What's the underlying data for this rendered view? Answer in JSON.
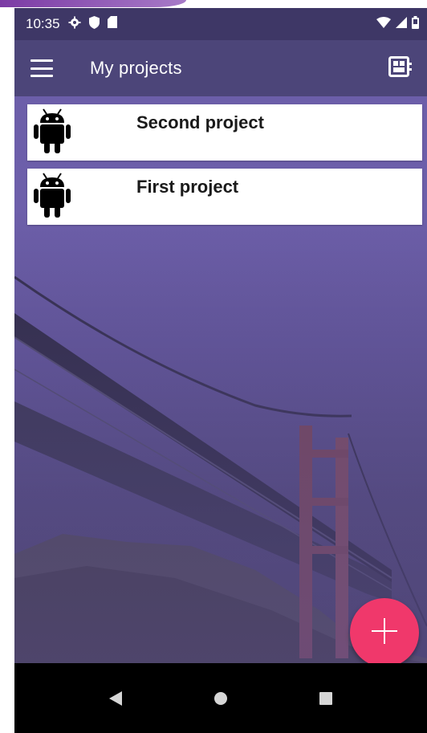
{
  "status_bar": {
    "time": "10:35",
    "left_icons": [
      "settings-icon",
      "shield-icon",
      "sd-card-icon"
    ],
    "right_icons": [
      "wifi-icon",
      "signal-icon",
      "battery-icon"
    ]
  },
  "app_bar": {
    "title": "My projects",
    "menu_icon": "hamburger-menu-icon",
    "action_icon": "dashboard-view-icon"
  },
  "projects": [
    {
      "title": "Second project",
      "icon": "android-icon"
    },
    {
      "title": "First project",
      "icon": "android-icon"
    }
  ],
  "fab": {
    "icon": "plus-icon",
    "color": "#f0386b"
  },
  "nav_bar": {
    "buttons": [
      "back-icon",
      "home-icon",
      "recents-icon"
    ]
  },
  "colors": {
    "status_bar": "#3e3766",
    "app_bar": "#4c4579",
    "background_tint": "#6c5ea9"
  }
}
